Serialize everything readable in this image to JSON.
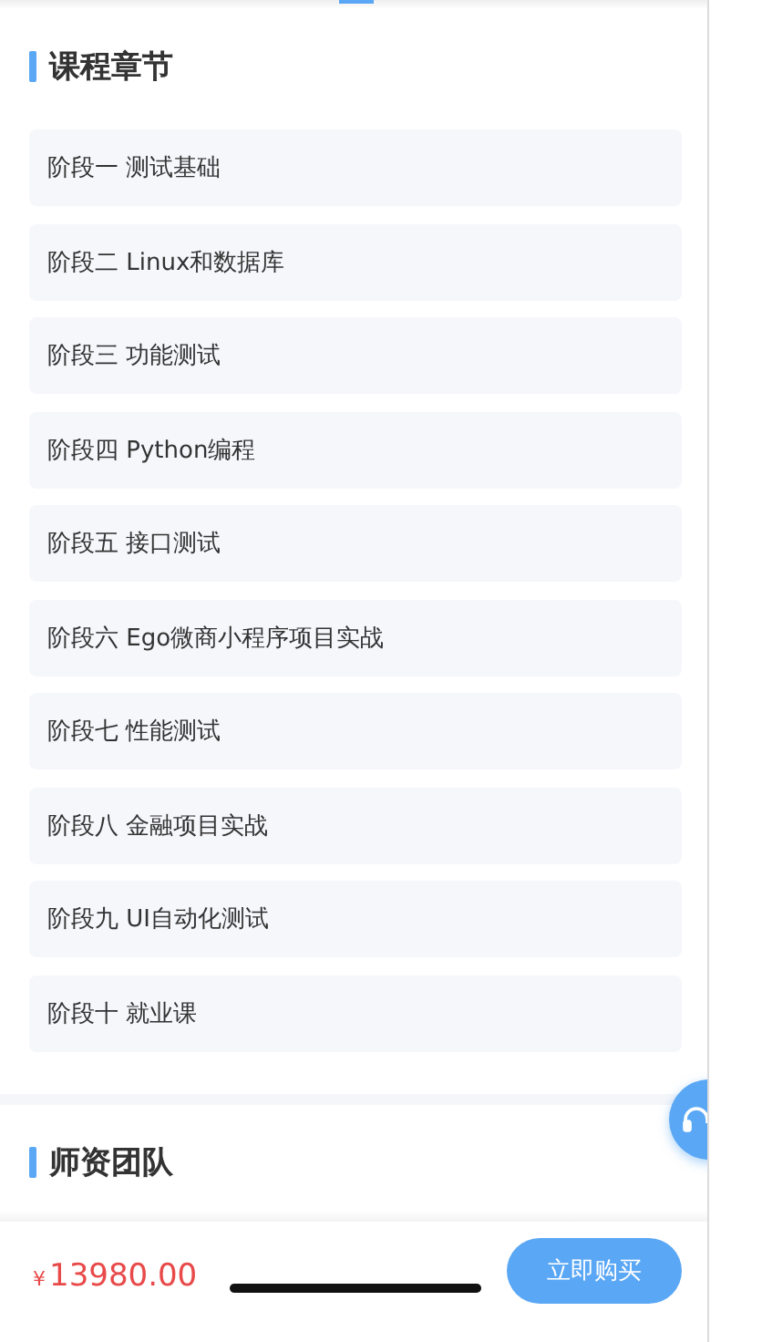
{
  "chapters_section": {
    "title": "课程章节",
    "items": [
      {
        "label": "阶段一 测试基础"
      },
      {
        "label": "阶段二 Linux和数据库"
      },
      {
        "label": "阶段三 功能测试"
      },
      {
        "label": "阶段四 Python编程"
      },
      {
        "label": "阶段五 接口测试"
      },
      {
        "label": "阶段六 Ego微商小程序项目实战"
      },
      {
        "label": "阶段七 性能测试"
      },
      {
        "label": "阶段八 金融项目实战"
      },
      {
        "label": "阶段九 UI自动化测试"
      },
      {
        "label": "阶段十 就业课"
      }
    ]
  },
  "teachers_section": {
    "title": "师资团队"
  },
  "bottom_bar": {
    "currency": "¥",
    "price": "13980.00",
    "buy_button": "立即购买"
  }
}
